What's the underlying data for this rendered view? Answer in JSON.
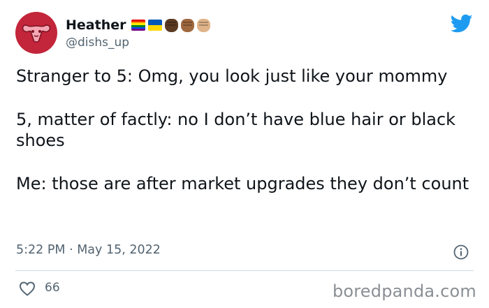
{
  "author": {
    "name": "Heather",
    "handle": "@dishs_up"
  },
  "tweet": {
    "paragraphs": [
      "Stranger to 5: Omg, you look just like your mommy",
      "5, matter of factly: no I don’t have blue hair or black shoes",
      "Me: those are after market upgrades they don’t count"
    ],
    "timestamp": "5:22 PM · May 15, 2022",
    "likes": "66"
  },
  "watermark": "boredpanda.com",
  "colors": {
    "twitter_blue": "#1d9bf0",
    "avatar_bg": "#c3253a",
    "secondary_text": "#536471"
  },
  "badges": [
    "rainbow-flag-icon",
    "ukraine-flag-icon",
    "dark-fist-icon",
    "medium-fist-icon",
    "light-fist-icon"
  ]
}
